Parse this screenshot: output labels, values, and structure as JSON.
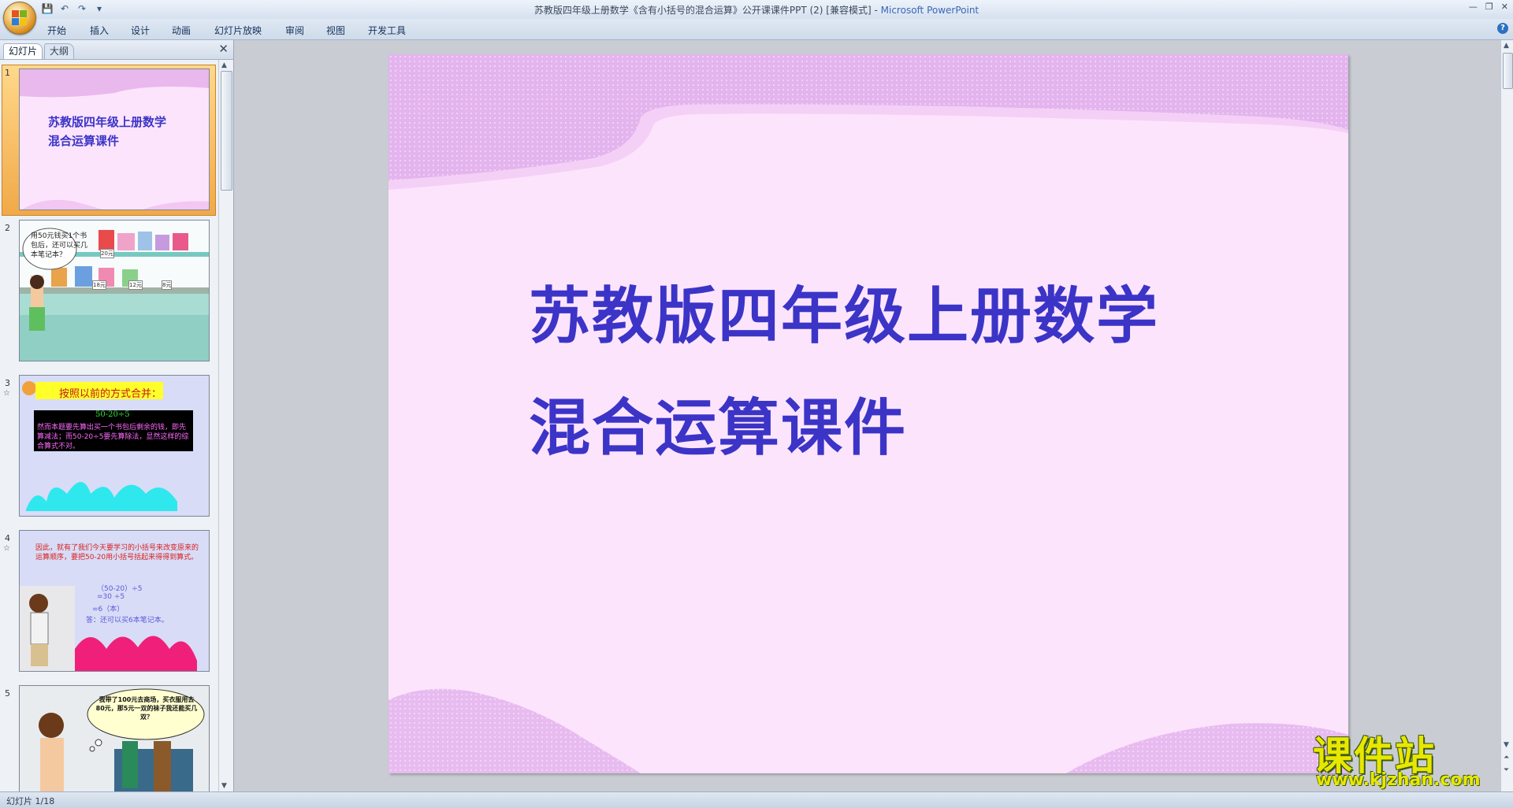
{
  "window": {
    "title_doc": "苏教版四年级上册数学《含有小括号的混合运算》公开课课件PPT (2) [兼容模式] -",
    "title_app": "Microsoft PowerPoint"
  },
  "ribbon": {
    "tabs": [
      "开始",
      "插入",
      "设计",
      "动画",
      "幻灯片放映",
      "审阅",
      "视图",
      "开发工具"
    ]
  },
  "panel": {
    "tabs": [
      "幻灯片",
      "大纲"
    ]
  },
  "thumbnails": [
    {
      "num": "1",
      "lines": [
        "苏教版四年级上册数学",
        "混合运算课件"
      ]
    },
    {
      "num": "2",
      "lines": [
        "用50元钱买1个书",
        "包后，还可以买几",
        "本笔记本？"
      ],
      "prices": [
        "20元",
        "18元",
        "12元",
        "8元"
      ]
    },
    {
      "num": "3",
      "banner": "按照以前的方式合并：",
      "expr": "50-20÷5",
      "desc": "然而本题要先算出买一个书包后剩余的钱，即先算减法；而50-20÷5要先算除法，显然这样的综合算式不对。"
    },
    {
      "num": "4",
      "intro": "因此，就有了我们今天要学习的小括号来改变原来的运算顺序，要把50-20用小括号括起来得得到算式。",
      "steps": [
        "（50-20）÷5",
        "=30 ÷5",
        "=6（本）"
      ],
      "answer": "答：还可以买6本笔记本。"
    },
    {
      "num": "5",
      "bubble": "我带了100元去商场，买衣服用去80元，那5元一双的袜子我还能买几双？"
    }
  ],
  "slide": {
    "title_line1": "苏教版四年级上册数学",
    "title_line2": "混合运算课件",
    "bg_color": "#fde4fd",
    "title_color": "#3b34c7"
  },
  "status": {
    "slide_indicator": "幻灯片 1/18"
  },
  "watermark": {
    "name": "课件站",
    "url": "www.kjzhan.com"
  }
}
